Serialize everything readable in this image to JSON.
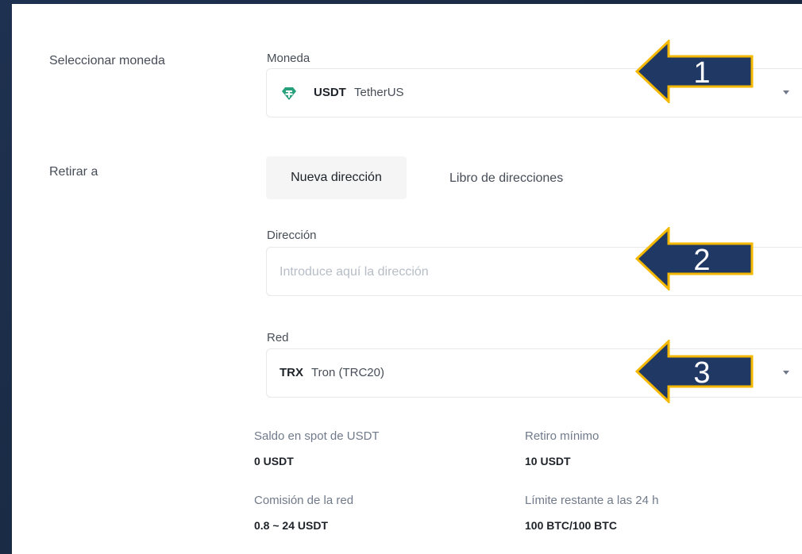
{
  "sections": {
    "select_coin": "Seleccionar moneda",
    "withdraw_to": "Retirar a"
  },
  "coin": {
    "label": "Moneda",
    "symbol": "USDT",
    "name": "TetherUS",
    "icon": "tether-icon",
    "icon_color": "#26a17b"
  },
  "tabs": {
    "new_address": "Nueva dirección",
    "address_book": "Libro de direcciones"
  },
  "address": {
    "label": "Dirección",
    "placeholder": "Introduce aquí la dirección"
  },
  "network": {
    "label": "Red",
    "symbol": "TRX",
    "name": "Tron (TRC20)"
  },
  "info": {
    "spot_balance_label": "Saldo en spot de USDT",
    "spot_balance_value": "0 USDT",
    "min_withdraw_label": "Retiro mínimo",
    "min_withdraw_value": "10 USDT",
    "network_fee_label": "Comisión de la red",
    "network_fee_value": "0.8 ~ 24 USDT",
    "limit_label": "Límite restante a las 24 h",
    "limit_value": "100 BTC/100 BTC"
  },
  "annotations": {
    "arrow_1": "1",
    "arrow_2": "2",
    "arrow_3": "3",
    "arrow_fill": "#1f3864",
    "arrow_border": "#f5b800"
  }
}
